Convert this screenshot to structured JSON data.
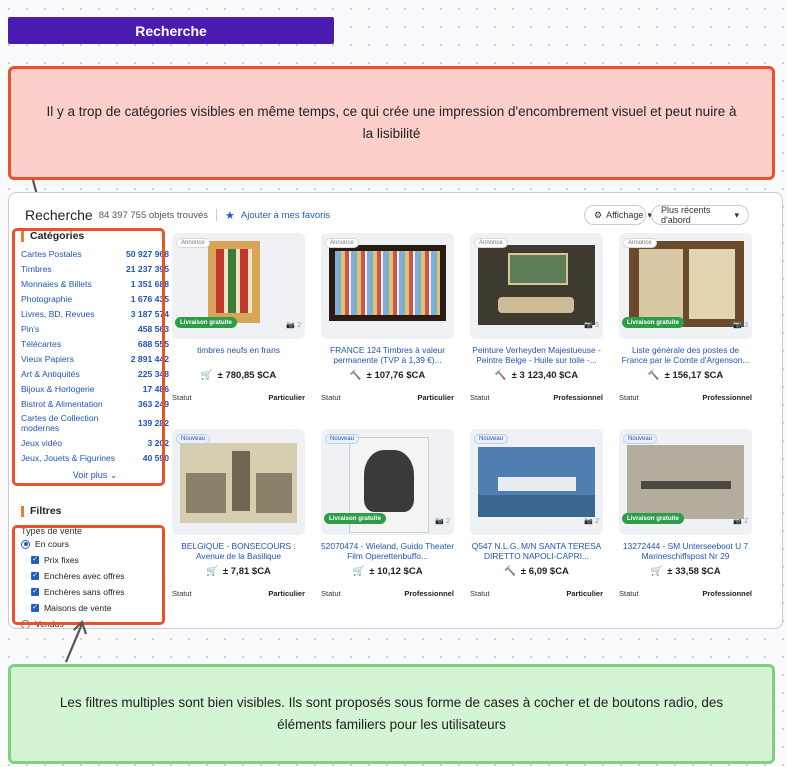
{
  "title": "Recherche",
  "notes": {
    "top": "Il y a trop de catégories visibles en même temps, ce qui crée une impression d'encombrement visuel et peut nuire à la lisibilité",
    "bottom": "Les filtres multiples sont bien visibles. Ils sont proposés sous forme de cases à cocher et de boutons radio, des éléments familiers pour les utilisateurs"
  },
  "header": {
    "title": "Recherche",
    "count": "84 397 755 objets trouvés",
    "favorite": "Ajouter à mes favoris",
    "display": "Affichage",
    "sort": "Plus récents d'abord"
  },
  "categories": {
    "title": "Catégories",
    "items": [
      {
        "label": "Cartes Postales",
        "count": "50 927 968"
      },
      {
        "label": "Timbres",
        "count": "21 237 395"
      },
      {
        "label": "Monnaies & Billets",
        "count": "1 351 688"
      },
      {
        "label": "Photographie",
        "count": "1 676 435"
      },
      {
        "label": "Livres, BD, Revues",
        "count": "3 187 574"
      },
      {
        "label": "Pin's",
        "count": "458 563"
      },
      {
        "label": "Télécartes",
        "count": "688 555"
      },
      {
        "label": "Vieux Papiers",
        "count": "2 891 442"
      },
      {
        "label": "Art & Antiquités",
        "count": "225 348"
      },
      {
        "label": "Bijoux & Horlogerie",
        "count": "17 486"
      },
      {
        "label": "Bistrot & Alimentation",
        "count": "363 249"
      },
      {
        "label": "Cartes de Collection modernes",
        "count": "139 282"
      },
      {
        "label": "Jeux vidéo",
        "count": "3 202"
      },
      {
        "label": "Jeux, Jouets & Figurines",
        "count": "40 590"
      }
    ],
    "more": "Voir plus"
  },
  "filters": {
    "title": "Filtres",
    "sale_type": "Types de vente",
    "en_cours": "En cours",
    "prix_fixes": "Prix fixes",
    "avec_offres": "Enchères avec offres",
    "sans_offres": "Enchères sans offres",
    "maisons": "Maisons de vente",
    "vendus": "Vendus"
  },
  "cards": [
    {
      "badge": "Annonce",
      "shipping": "Livraison gratuite",
      "photos": "2",
      "title": "timbres neufs en frans",
      "price": "± 780,85 $CA",
      "price_icon": "cart-icon",
      "status": "Statut",
      "seller": "Particulier"
    },
    {
      "badge": "Annonce",
      "shipping": "",
      "photos": "",
      "title": "FRANCE 124 Timbres à valeur permanente (TVP à 1,39 €)...",
      "price": "± 107,76 $CA",
      "price_icon": "gavel-icon",
      "status": "Statut",
      "seller": "Particulier"
    },
    {
      "badge": "Annonce",
      "shipping": "",
      "photos": "5",
      "title": "Peinture Verheyden Majestueuse - Peintre Belge - Huile sur toile -...",
      "price": "± 3 123,40 $CA",
      "price_icon": "gavel-icon",
      "status": "Statut",
      "seller": "Professionnel"
    },
    {
      "badge": "Annonce",
      "shipping": "Livraison gratuite",
      "photos": "3",
      "title": "Liste générale des postes de France par le Comte d'Argenson...",
      "price": "± 156,17 $CA",
      "price_icon": "gavel-icon",
      "status": "Statut",
      "seller": "Professionnel"
    },
    {
      "badge": "Nouveau",
      "shipping": "",
      "photos": "",
      "title": "BELGIQUE - BONSECOURS : Avenue de la Basilique",
      "price": "± 7,81 $CA",
      "price_icon": "cart-icon",
      "status": "Statut",
      "seller": "Particulier"
    },
    {
      "badge": "Nouveau",
      "shipping": "Livraison gratuite",
      "photos": "2",
      "title": "52070474 - Wieland, Guido Theater Film Operettenbuffo...",
      "price": "± 10,12 $CA",
      "price_icon": "cart-icon",
      "status": "Statut",
      "seller": "Professionnel"
    },
    {
      "badge": "Nouveau",
      "shipping": "",
      "photos": "2",
      "title": "Q547 N.L.G. M/N SANTA TERESA DIRETTO NAPOLI-CAPRI...",
      "price": "± 6,09 $CA",
      "price_icon": "gavel-icon",
      "status": "Statut",
      "seller": "Particulier"
    },
    {
      "badge": "Nouveau",
      "shipping": "Livraison gratuite",
      "photos": "2",
      "title": "13272444 - SM Unterseeboot U 7 Marineschiffspost Nr 29",
      "price": "± 33,58 $CA",
      "price_icon": "cart-icon",
      "status": "Statut",
      "seller": "Professionnel"
    }
  ]
}
